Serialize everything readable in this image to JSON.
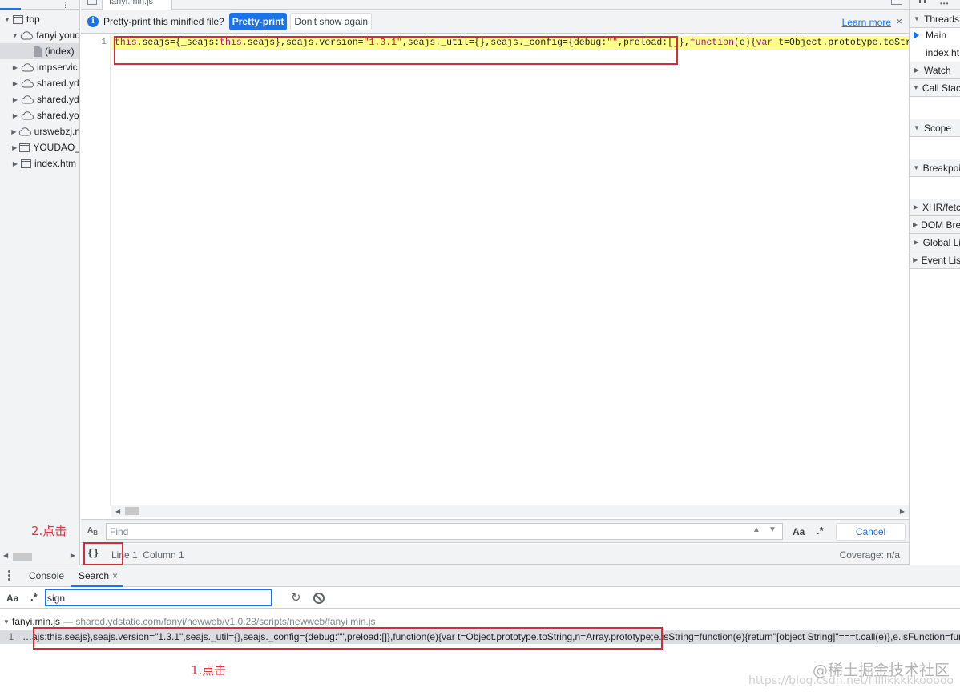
{
  "navigator": {
    "tree": [
      {
        "label": "top",
        "icon": "frame-icon",
        "expanded": true
      },
      {
        "label": "fanyi.youd",
        "icon": "cloud-icon",
        "expanded": true
      },
      {
        "label": "(index)",
        "icon": "file-icon",
        "selected": true
      },
      {
        "label": "impservic",
        "icon": "cloud-icon"
      },
      {
        "label": "shared.yd",
        "icon": "cloud-icon"
      },
      {
        "label": "shared.yd",
        "icon": "cloud-icon"
      },
      {
        "label": "shared.yo",
        "icon": "cloud-icon"
      },
      {
        "label": "urswebzj.n",
        "icon": "cloud-icon"
      },
      {
        "label": "YOUDAO_",
        "icon": "frame-icon"
      },
      {
        "label": "index.htm",
        "icon": "frame-icon"
      }
    ]
  },
  "editor": {
    "tab_label": "fanyi.min.js",
    "infobar": {
      "message": "Pretty-print this minified file?",
      "pretty_print_label": "Pretty-print",
      "dont_show_label": "Don't show again",
      "learn_more_label": "Learn more",
      "close_label": "×"
    },
    "line_number": "1",
    "code_tokens": [
      {
        "t": "this",
        "k": "kw"
      },
      {
        "t": ".seajs={_seajs:",
        "k": "plain"
      },
      {
        "t": "this",
        "k": "kw"
      },
      {
        "t": ".seajs},seajs.version=",
        "k": "plain"
      },
      {
        "t": "\"1.3.1\"",
        "k": "str"
      },
      {
        "t": ",seajs._util={},seajs._config={debug:",
        "k": "plain"
      },
      {
        "t": "\"\"",
        "k": "str"
      },
      {
        "t": ",preload:[]},",
        "k": "plain"
      },
      {
        "t": "function",
        "k": "kw"
      },
      {
        "t": "(e){",
        "k": "plain"
      },
      {
        "t": "var",
        "k": "kw"
      },
      {
        "t": " t=Object.prototype.toString,n=Array.prototype;e.isString=",
        "k": "plain"
      }
    ],
    "find": {
      "placeholder": "Find",
      "case_label": "Aa",
      "regex_label": ".*",
      "cancel_label": "Cancel"
    },
    "status": {
      "pretty_print_icon": "{}",
      "position": "Line 1, Column 1",
      "coverage": "Coverage: n/a"
    }
  },
  "debugger": {
    "threads_label": "Threads",
    "thread_main": "Main",
    "thread_index": "index.ht",
    "watch_label": "Watch",
    "call_stack_label": "Call Stack",
    "scope_label": "Scope",
    "breakpoints_label": "Breakpoi",
    "xhr_label": "XHR/fetc",
    "dom_label": "DOM Bre",
    "global_label": "Global Li",
    "event_label": "Event Lis"
  },
  "drawer": {
    "console_tab": "Console",
    "search_tab": "Search",
    "close_label": "×",
    "search_case_label": "Aa",
    "search_regex_label": ".*",
    "search_value": "sign",
    "result_file": "fanyi.min.js",
    "result_path": "— shared.ydstatic.com/fanyi/newweb/v1.0.28/scripts/newweb/fanyi.min.js",
    "match_line": "1",
    "match_text": "…ajs:this.seajs},seajs.version=\"1.3.1\",seajs._util={},seajs._config={debug:\"\",preload:[]},function(e){var t=Object.prototype.toString,n=Array.prototype;e.isString=function(e){return\"[object String]\"===t.call(e)},e.isFunction=function"
  },
  "annotations": {
    "step1": "1.点击",
    "step2": "2.点击",
    "color": "#d9283a"
  },
  "watermark": {
    "brand": "@稀土掘金技术社区",
    "url": "https://blog.csdn.net/llllllkkkkkooooo"
  },
  "colors": {
    "accent": "#1a73e8",
    "highlight": "#ffff8c"
  }
}
